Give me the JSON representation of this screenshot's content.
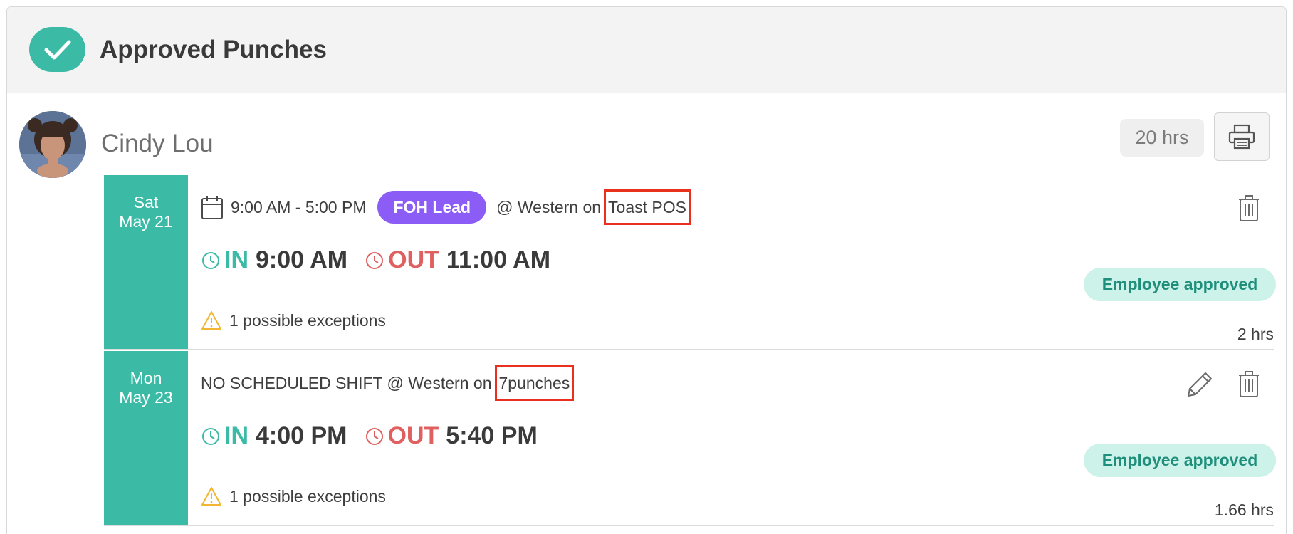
{
  "header": {
    "title": "Approved Punches",
    "icon": "check-icon",
    "accent": "#3bbba6"
  },
  "employee": {
    "name": "Cindy Lou",
    "total_hours": "20 hrs",
    "print_icon": "printer-icon"
  },
  "shifts": [
    {
      "day": "Sat",
      "date": "May 21",
      "time_range": "9:00 AM - 5:00 PM",
      "role": "FOH Lead",
      "location": "@ Western on",
      "source": "Toast POS",
      "in_label": "IN",
      "in_time": "9:00 AM",
      "out_label": "OUT",
      "out_time": "11:00 AM",
      "exceptions": "1 possible exceptions",
      "status": "Employee approved",
      "hours": "2 hrs"
    },
    {
      "day": "Mon",
      "date": "May 23",
      "schedule_text": "NO SCHEDULED SHIFT @ Western on",
      "source": "7punches",
      "in_label": "IN",
      "in_time": "4:00 PM",
      "out_label": "OUT",
      "out_time": "5:40 PM",
      "exceptions": "1 possible exceptions",
      "status": "Employee approved",
      "hours": "1.66 hrs"
    }
  ],
  "colors": {
    "teal": "#3bbba6",
    "out_red": "#e06060",
    "role_purple": "#8b5cf6",
    "status_bg": "#cdf2ea",
    "highlight_red": "#e8301c",
    "warning_yellow": "#f2b632"
  }
}
